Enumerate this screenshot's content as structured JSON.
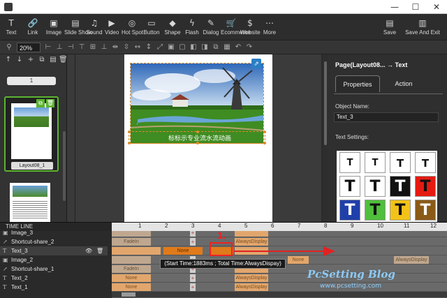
{
  "window": {
    "minimize_glyph": "—",
    "maximize_glyph": "☐",
    "close_glyph": "✕"
  },
  "toolbar": {
    "tools": [
      {
        "label": "Text",
        "icon": "T",
        "icon_name": "text-icon"
      },
      {
        "label": "Link",
        "icon": "🔗",
        "icon_name": "link-icon"
      },
      {
        "label": "Image",
        "icon": "▣",
        "icon_name": "image-icon"
      },
      {
        "label": "Slide Show",
        "icon": "▤",
        "icon_name": "slideshow-icon"
      },
      {
        "label": "Sound",
        "icon": "♫",
        "icon_name": "sound-icon"
      },
      {
        "label": "Video",
        "icon": "▶",
        "icon_name": "video-icon"
      },
      {
        "label": "Hot Spot",
        "icon": "◎",
        "icon_name": "hotspot-icon"
      },
      {
        "label": "Button",
        "icon": "▭",
        "icon_name": "button-icon"
      },
      {
        "label": "Shape",
        "icon": "◆",
        "icon_name": "shape-icon"
      },
      {
        "label": "Flash",
        "icon": "ϟ",
        "icon_name": "flash-icon"
      },
      {
        "label": "Dialog",
        "icon": "✎",
        "icon_name": "dialog-icon"
      },
      {
        "label": "Ecommerce",
        "icon": "🛒",
        "icon_name": "cart-icon"
      },
      {
        "label": "Website",
        "icon": "$",
        "icon_name": "website-icon"
      },
      {
        "label": "More",
        "icon": "⋯",
        "icon_name": "more-icon"
      }
    ],
    "save_label": "Save",
    "save_exit_label": "Save And Exit"
  },
  "subtoolbar": {
    "zoom_value": "20%"
  },
  "page_panel": {
    "page_number": "1",
    "page_name": "Layout08_1"
  },
  "canvas": {
    "selected_text": "标标示专业流水流动画"
  },
  "properties": {
    "heading": "Page(Layout08... → Text",
    "tab_properties": "Properties",
    "tab_action": "Action",
    "object_name_label": "Object Name:",
    "object_name_value": "Text_3",
    "text_settings_label": "Text Settings:",
    "text_styles": [
      {
        "bg": "#ffffff",
        "fg": "#111111",
        "letter": "T",
        "size": "13px"
      },
      {
        "bg": "#ffffff",
        "fg": "#111111",
        "letter": "T",
        "size": "13px"
      },
      {
        "bg": "#ffffff",
        "fg": "#111111",
        "letter": "T",
        "size": "15px"
      },
      {
        "bg": "#ffffff",
        "fg": "#111111",
        "letter": "T",
        "size": "15px"
      },
      {
        "bg": "#ffffff",
        "fg": "#111111",
        "letter": "T",
        "size": "22px"
      },
      {
        "bg": "#ffffff",
        "fg": "#111111",
        "letter": "T",
        "size": "22px"
      },
      {
        "bg": "#111111",
        "fg": "#ffffff",
        "letter": "T",
        "size": "22px"
      },
      {
        "bg": "#e51b12",
        "fg": "#111111",
        "letter": "T",
        "size": "22px"
      },
      {
        "bg": "#1f3faa",
        "fg": "#ffffff",
        "letter": "T",
        "size": "22px"
      },
      {
        "bg": "#4fbf3c",
        "fg": "#111111",
        "letter": "T",
        "size": "22px"
      },
      {
        "bg": "#f2c218",
        "fg": "#111111",
        "letter": "T",
        "size": "22px"
      },
      {
        "bg": "#8a5a17",
        "fg": "#ffffff",
        "letter": "T",
        "size": "22px"
      }
    ]
  },
  "timeline": {
    "title": "TIME LINE",
    "ruler_numbers": [
      "1",
      "2",
      "3",
      "4",
      "5",
      "6",
      "7",
      "8",
      "9",
      "10",
      "11",
      "12"
    ],
    "layers": [
      {
        "name": "Image_3",
        "selected": false
      },
      {
        "name": "Shortcut-share_2",
        "selected": false
      },
      {
        "name": "Text_3",
        "selected": true
      },
      {
        "name": "Image_2",
        "selected": false
      },
      {
        "name": "Shortcut-share_1",
        "selected": false
      },
      {
        "name": "Text_2",
        "selected": false
      },
      {
        "name": "Text_1",
        "selected": false
      }
    ],
    "seg_fadein": "FadeIn",
    "seg_none": "None",
    "seg_always": "AlwaysDisplay",
    "tooltip": "(Start Time:1883ms ; Total Time:AlwaysDispay)",
    "annotation_label": "1."
  },
  "watermark": {
    "title": "PcSetting Blog",
    "url": "www.pcsetting.com"
  },
  "colors": {
    "accent_green": "#5bb430",
    "highlight_red": "#e22222",
    "segment_orange": "#e2a66c"
  }
}
